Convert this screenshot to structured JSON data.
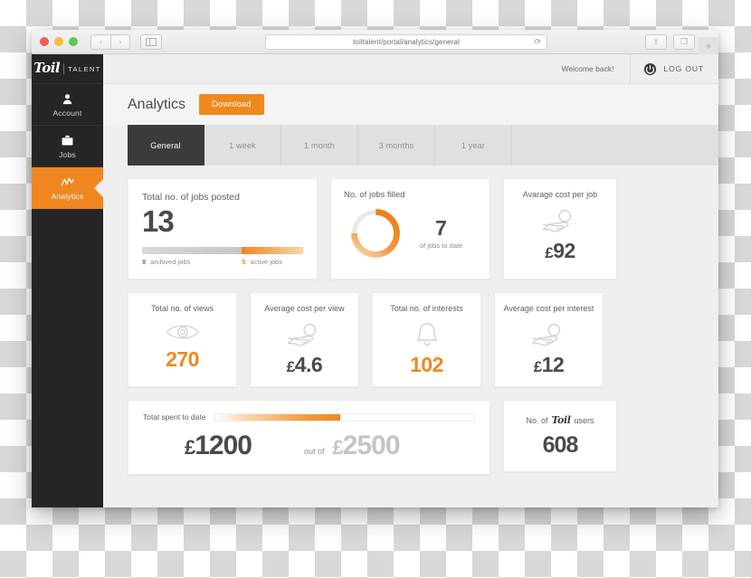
{
  "browser": {
    "url": "toiltalent/portal/analytics/general",
    "back_label": "‹",
    "forward_label": "›",
    "reload_label": "⟳",
    "newtab_label": "+",
    "share_label": "⇪",
    "tabs_label": "❐"
  },
  "sidebar": {
    "logo": {
      "brand": "Toil",
      "suffix": "TALENT"
    },
    "items": [
      {
        "label": "Account",
        "icon": "user-icon",
        "active": false
      },
      {
        "label": "Jobs",
        "icon": "briefcase-icon",
        "active": false
      },
      {
        "label": "Analytics",
        "icon": "chart-icon",
        "active": true
      }
    ]
  },
  "topbar": {
    "welcome": "Welcome back!",
    "logout_label": "LOG OUT",
    "logout_icon": "power-icon"
  },
  "header": {
    "title": "Analytics",
    "download_label": "Download"
  },
  "tabs": [
    {
      "label": "General",
      "active": true
    },
    {
      "label": "1 week",
      "active": false
    },
    {
      "label": "1 month",
      "active": false
    },
    {
      "label": "3 months",
      "active": false
    },
    {
      "label": "1 year",
      "active": false
    }
  ],
  "cards": {
    "jobs_posted": {
      "title": "Total no. of jobs posted",
      "value": "13",
      "archived_count": "8",
      "archived_label": "archived jobs",
      "active_count": "5",
      "active_label": "active jobs"
    },
    "jobs_filled": {
      "title": "No. of jobs filled",
      "value": "7",
      "subtitle": "of jobs to date"
    },
    "avg_cost_per_job": {
      "title": "Avarage cost per job",
      "value": "92",
      "currency": "£",
      "icon": "hand-coin-icon"
    },
    "total_views": {
      "title": "Total no. of views",
      "value": "270",
      "currency": "",
      "icon": "eye-icon"
    },
    "avg_cost_per_view": {
      "title": "Average cost per view",
      "value": "4.6",
      "currency": "£",
      "icon": "hand-coin-icon"
    },
    "total_interests": {
      "title": "Total no. of interests",
      "value": "102",
      "currency": "",
      "icon": "bell-icon"
    },
    "avg_cost_per_interest": {
      "title": "Average cost per interest",
      "value": "12",
      "currency": "£",
      "icon": "hand-coin-icon"
    },
    "total_spent": {
      "title": "Total spent to date",
      "currency": "£",
      "spent": "1200",
      "out_of_label": "out of",
      "budget": "2500"
    },
    "toil_users": {
      "prefix": "No. of",
      "brand": "Toil",
      "suffix": "users",
      "value": "608"
    }
  },
  "chart_data": [
    {
      "type": "pie",
      "title": "No. of jobs filled",
      "categories": [
        "filled",
        "remaining"
      ],
      "values": [
        75,
        25
      ],
      "center_value": 7,
      "center_label": "of jobs to date",
      "colors": [
        "#f0871e",
        "#ffffff"
      ]
    },
    {
      "type": "bar",
      "title": "Total no. of jobs posted",
      "categories": [
        "archived jobs",
        "active jobs"
      ],
      "values": [
        8,
        5
      ],
      "total": 13,
      "colors": [
        "#cfcfcf",
        "#f0871e"
      ],
      "orientation": "stacked-horizontal"
    },
    {
      "type": "bar",
      "title": "Total spent to date",
      "categories": [
        "spent",
        "budget"
      ],
      "values": [
        1200,
        2500
      ],
      "percent": 48,
      "colors": [
        "#f0871e",
        "#ffffff"
      ],
      "orientation": "progress"
    }
  ],
  "theme": {
    "accent": "#f0871e",
    "dark": "#252525",
    "text_dark": "#4a4a4a",
    "text_muted": "#8d8d8d"
  }
}
